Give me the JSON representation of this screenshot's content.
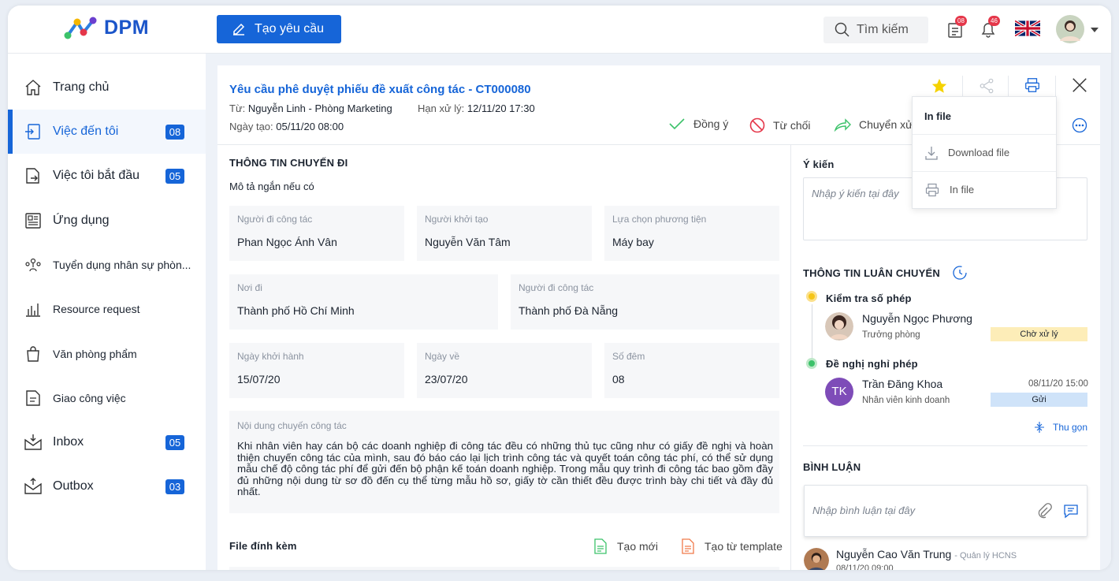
{
  "app": {
    "logo_text": "DPM",
    "create_label": "Tạo yêu cầu",
    "search_placeholder": "Tìm kiếm",
    "doc_badge": "08",
    "notif_badge": "46",
    "accent": "#1665d8"
  },
  "sidebar": {
    "items": [
      {
        "label": "Trang chủ",
        "count": ""
      },
      {
        "label": "Việc đến tôi",
        "count": "08"
      },
      {
        "label": "Việc tôi bắt đầu",
        "count": "05"
      },
      {
        "label": "Ứng dụng",
        "count": ""
      },
      {
        "label": "Tuyển dụng nhân sự phòn...",
        "count": ""
      },
      {
        "label": "Resource request",
        "count": ""
      },
      {
        "label": "Văn phòng phẩm",
        "count": ""
      },
      {
        "label": "Giao công việc",
        "count": ""
      },
      {
        "label": "Inbox",
        "count": "05"
      },
      {
        "label": "Outbox",
        "count": "03"
      }
    ]
  },
  "request": {
    "title": "Yêu cầu phê duyệt phiếu đề xuất công tác - CT000080",
    "from_label": "Từ:",
    "from_value": "Nguyễn Linh - Phòng Marketing",
    "deadline_label": "Hạn xử lý:",
    "deadline_value": "12/11/20 17:30",
    "created_label": "Ngày tạo:",
    "created_value": "05/11/20 08:00",
    "actions": {
      "approve": "Đồng ý",
      "reject": "Từ chối",
      "forward": "Chuyển xử"
    }
  },
  "trip": {
    "section_title": "THÔNG TIN CHUYẾN ĐI",
    "short_desc": "Mô tả ngắn nếu có",
    "fields": [
      {
        "label": "Người đi công tác",
        "value": "Phan Ngọc Ánh Vân"
      },
      {
        "label": "Người khởi tạo",
        "value": "Nguyễn Văn Tâm"
      },
      {
        "label": "Lựa chọn phương tiện",
        "value": "Máy bay"
      },
      {
        "label": "Nơi đi",
        "value": "Thành phố Hồ Chí Minh"
      },
      {
        "label": "Người đi công tác",
        "value": "Thành phố Đà Nẵng"
      },
      {
        "label": "Ngày khởi hành",
        "value": "15/07/20"
      },
      {
        "label": "Ngày về",
        "value": "23/07/20"
      },
      {
        "label": "Số đêm",
        "value": "08"
      }
    ],
    "content_label": "Nội dung chuyến công tác",
    "content_text": "Khi nhân viên hay cán bộ các doanh nghiệp đi công tác đều có những thủ tục cũng như có giấy đề nghị và hoàn thiện chuyến công tác của mình, sau đó báo cáo lại lịch trình công tác và quyết toán công tác phí, có thể sử dụng mẫu chế độ công tác phí để gửi đến bộ phận kế toán doanh nghiệp. Trong mẫu quy trình đi công tác bao gồm đầy đủ những nội dung từ sơ đồ đến cụ thể từng mẫu hồ sơ, giấy tờ cần thiết đều được trình bày chi tiết và đầy đủ nhất."
  },
  "attachments": {
    "title": "File đính kèm",
    "new_label": "Tạo mới",
    "template_label": "Tạo từ template"
  },
  "opinion": {
    "title": "Ý kiến",
    "placeholder": "Nhập ý kiến tại đây"
  },
  "workflow": {
    "title": "THÔNG TIN LUÂN CHUYỂN",
    "steps": [
      {
        "step": "Kiểm tra số phép",
        "name": "Nguyễn Ngọc Phương",
        "role": "Trưởng phòng",
        "time": "",
        "status": "Chờ xử lý",
        "status_color": "#fdedb8",
        "dot_color": "#f5c518"
      },
      {
        "step": "Đề nghị nghỉ phép",
        "name": "Trần Đăng Khoa",
        "role": "Nhân viên kinh doanh",
        "time": "08/11/20 15:00",
        "status": "Gửi",
        "status_color": "#cfe3f9",
        "dot_color": "#3cc26a",
        "initials": "TK"
      }
    ],
    "collapse_label": "Thu gọn"
  },
  "comments": {
    "title": "BÌNH LUẬN",
    "placeholder": "Nhập bình luận tại đây",
    "items": [
      {
        "name": "Nguyễn Cao Văn Trung",
        "role": "- Quản lý HCNS",
        "time": "08/11/20 09:00"
      }
    ]
  },
  "print_menu": {
    "title": "In file",
    "items": [
      {
        "label": "Download file"
      },
      {
        "label": "In file"
      }
    ]
  }
}
